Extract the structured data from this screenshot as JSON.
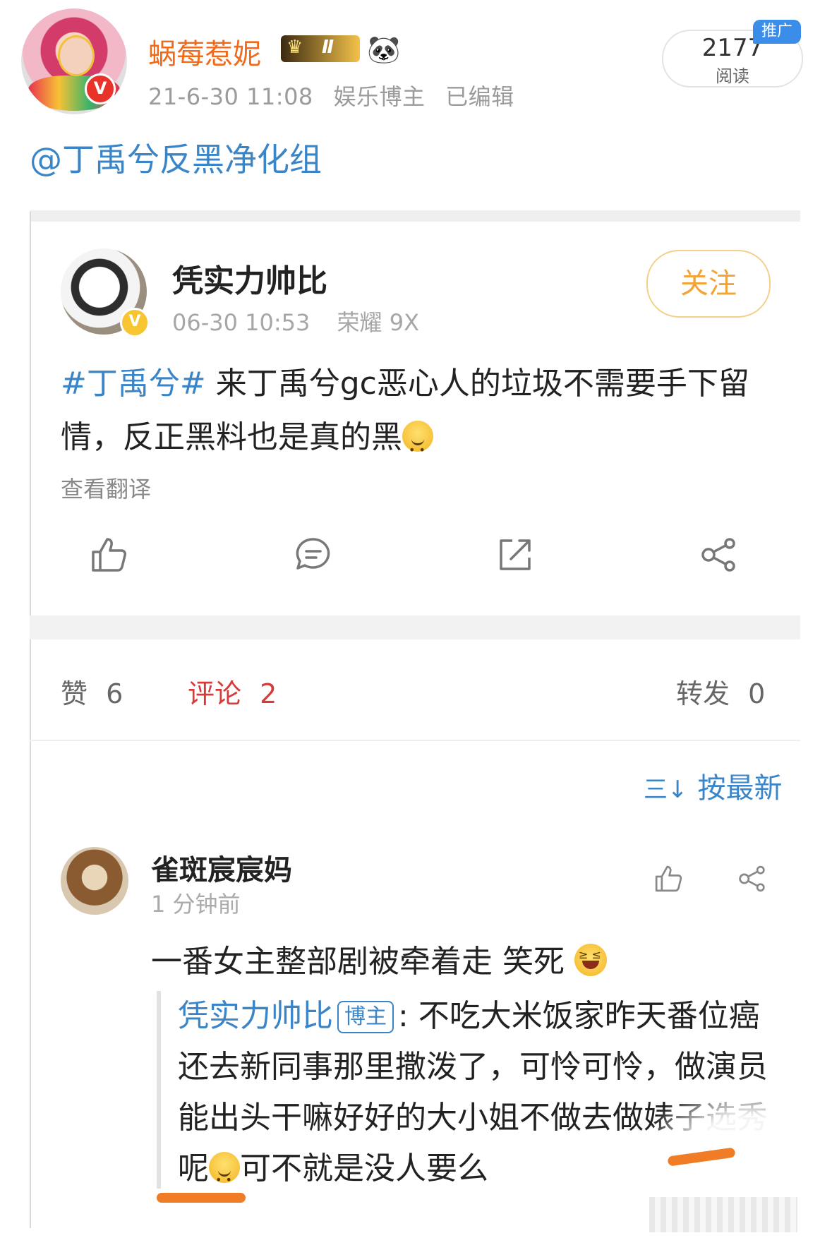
{
  "header": {
    "username": "蜗莓惹妮",
    "level_badge": "Ⅱ",
    "crown_glyph": "♛",
    "panda_glyph": "🐼",
    "verified_glyph": "V",
    "date": "21-6-30 11:08",
    "category": "娱乐博主",
    "edited": "已编辑",
    "read_count": "2177",
    "read_label": "阅读",
    "promo_tag": "推广"
  },
  "mention": "@丁禹兮反黑净化组",
  "shared_post": {
    "username": "凭实力帅比",
    "time": "06-30 10:53",
    "device": "荣耀 9X",
    "follow_label": "关注",
    "hashtag": "#丁禹兮#",
    "text": " 来丁禹兮gc恶心人的垃圾不需要手下留情，反正黑料也是真的黑",
    "translate_label": "查看翻译",
    "stats": {
      "like_label": "赞",
      "like_count": "6",
      "comment_label": "评论",
      "comment_count": "2",
      "repost_label": "转发",
      "repost_count": "0"
    },
    "sort_icon": "三↓",
    "sort_label": "按最新"
  },
  "comment": {
    "username": "雀斑宸宸妈",
    "time": "1 分钟前",
    "text": "一番女主整部剧被牵着走 笑死 ",
    "reply": {
      "username": "凭实力帅比",
      "tag": "博主",
      "text_part1": ": 不吃大米饭家昨天番位癌还去新同事那里撒泼了，可怜可怜，做演员能出头干嘛好好的大小姐不做去做婊子选秀呢",
      "text_part2": "可不就是没人要么"
    }
  },
  "colors": {
    "link_blue": "#3a84c8",
    "username_orange": "#f06a1c",
    "comment_red": "#d83a3a",
    "follow_orange": "#f2a33a"
  }
}
